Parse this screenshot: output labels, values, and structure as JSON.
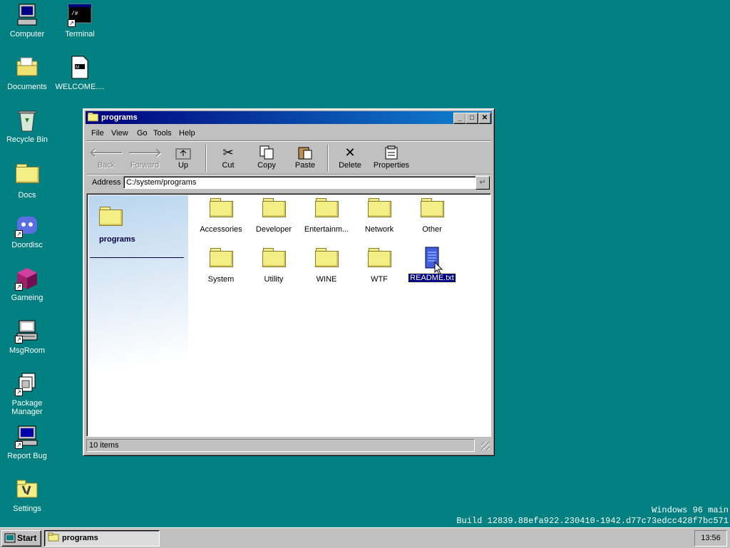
{
  "desktop": {
    "icons": [
      {
        "label": "Computer",
        "icon": "computer-icon"
      },
      {
        "label": "Terminal",
        "icon": "terminal-icon"
      },
      {
        "label": "Documents",
        "icon": "documents-folder-icon"
      },
      {
        "label": "WELCOME....",
        "icon": "markdown-file-icon"
      },
      {
        "label": "Recycle Bin",
        "icon": "recycle-bin-icon"
      },
      {
        "label": "Docs",
        "icon": "folder-icon"
      },
      {
        "label": "Doordisc",
        "icon": "doordisc-icon"
      },
      {
        "label": "Gameing",
        "icon": "gameing-icon"
      },
      {
        "label": "MsgRoom",
        "icon": "msgroom-icon"
      },
      {
        "label": "Package Manager",
        "icon": "package-manager-icon"
      },
      {
        "label": "Report Bug",
        "icon": "report-bug-icon"
      },
      {
        "label": "Settings",
        "icon": "settings-icon"
      }
    ],
    "build_line1": "Windows 96 main",
    "build_line2": "Build 12839.88efa922.230410-1942.d77c73edcc428f7bc571"
  },
  "window": {
    "title": "programs",
    "menu": [
      "File",
      "View",
      "Go",
      "Tools",
      "Help"
    ],
    "toolbar": [
      {
        "label": "Back",
        "icon": "back-arrow-icon",
        "enabled": false
      },
      {
        "label": "Forward",
        "icon": "forward-arrow-icon",
        "enabled": false
      },
      {
        "label": "Up",
        "icon": "up-folder-icon",
        "enabled": true
      },
      {
        "label": "Cut",
        "icon": "scissors-icon",
        "enabled": true
      },
      {
        "label": "Copy",
        "icon": "copy-icon",
        "enabled": true
      },
      {
        "label": "Paste",
        "icon": "paste-icon",
        "enabled": true
      },
      {
        "label": "Delete",
        "icon": "delete-x-icon",
        "enabled": true
      },
      {
        "label": "Properties",
        "icon": "properties-icon",
        "enabled": true
      }
    ],
    "address_label": "Address",
    "address_value": "C:/system/programs",
    "side_panel_title": "programs",
    "items": [
      {
        "label": "Accessories",
        "type": "folder"
      },
      {
        "label": "Developer",
        "type": "folder"
      },
      {
        "label": "Entertainm...",
        "type": "folder"
      },
      {
        "label": "Network",
        "type": "folder"
      },
      {
        "label": "Other",
        "type": "folder"
      },
      {
        "label": "System",
        "type": "folder"
      },
      {
        "label": "Utility",
        "type": "folder"
      },
      {
        "label": "WINE",
        "type": "folder"
      },
      {
        "label": "WTF",
        "type": "folder"
      },
      {
        "label": "README.txt",
        "type": "text-file",
        "selected": true
      }
    ],
    "status": "10 items"
  },
  "taskbar": {
    "start_label": "Start",
    "task_label": "programs",
    "clock": "13:56"
  },
  "colors": {
    "desktop": "#008080",
    "titlebar_start": "#00007b",
    "titlebar_end": "#1084d0",
    "selection": "#000080",
    "folder": "#f4ee86"
  }
}
